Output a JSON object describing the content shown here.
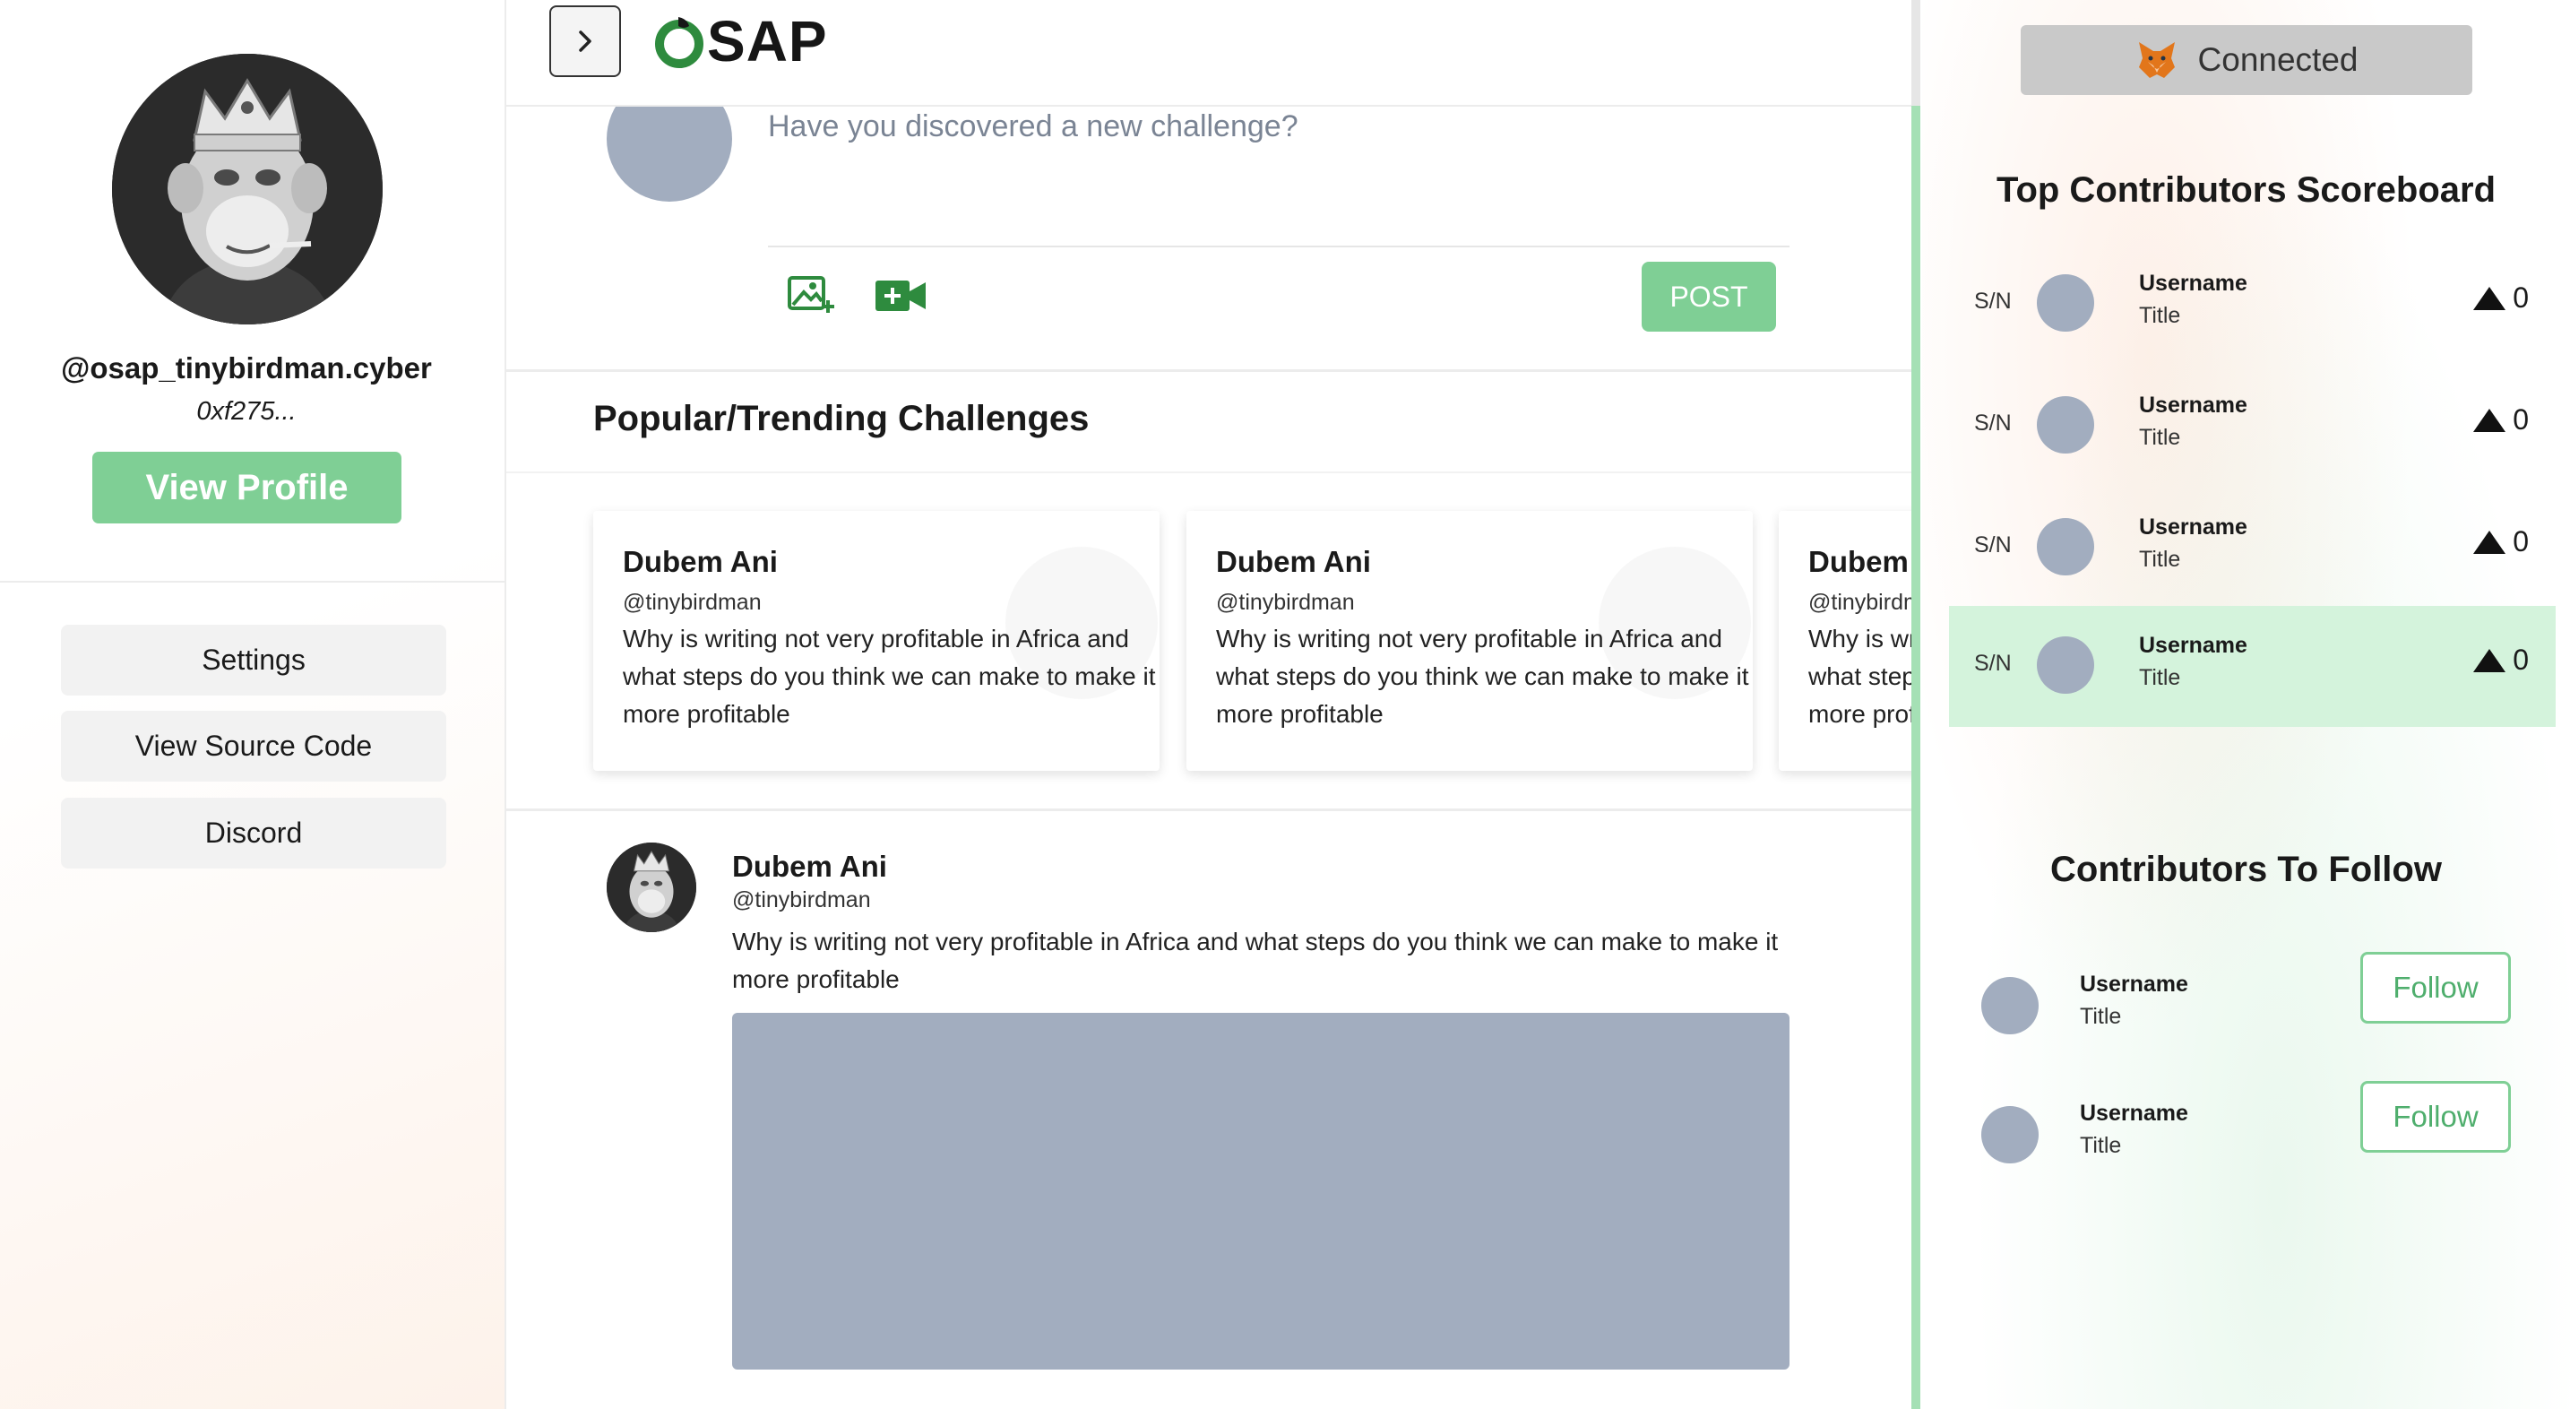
{
  "colors": {
    "accent_green": "#7fcf95",
    "placeholder_gray": "#a2adbf",
    "icon_green": "#2e8b3e",
    "highlight_row": "#d4f3dc"
  },
  "left": {
    "handle": "@osap_tinybirdman.cyber",
    "address": "0xf275...",
    "view_profile": "View Profile",
    "menu": [
      {
        "label": "Settings",
        "icon": "none"
      },
      {
        "label": "View Source Code",
        "icon": "none"
      },
      {
        "label": "Discord",
        "icon": "none"
      }
    ]
  },
  "topbar": {
    "logo_text": "SAP",
    "toggle_icon": "chevron-right-icon"
  },
  "composer": {
    "placeholder": "Have you discovered a new challenge?",
    "add_image_icon": "add-image-icon",
    "add_video_icon": "add-video-icon",
    "post_label": "POST"
  },
  "trending": {
    "title": "Popular/Trending Challenges",
    "cards": [
      {
        "name": "Dubem Ani",
        "handle": "@tinybirdman",
        "text": "Why is writing not very profitable in Africa and what steps do you think we can make to make it more profitable"
      },
      {
        "name": "Dubem Ani",
        "handle": "@tinybirdman",
        "text": "Why is writing not very profitable in Africa and what steps do you think we can make to make it more profitable"
      },
      {
        "name": "Dubem Ani",
        "handle": "@tinybirdman",
        "text": "Why is writing not very profitable in Africa and what steps do you think we can make to make it more profitable"
      }
    ]
  },
  "feed": {
    "name": "Dubem Ani",
    "handle": "@tinybirdman",
    "text": "Why is writing not very profitable in Africa and what steps do you think we can make to make it more profitable"
  },
  "right": {
    "connected_label": "Connected",
    "wallet_icon": "fox-icon",
    "scoreboard_title": "Top Contributors Scoreboard",
    "scoreboard": [
      {
        "sn": "S/N",
        "username": "Username",
        "title": "Title",
        "score": "0",
        "highlighted": false
      },
      {
        "sn": "S/N",
        "username": "Username",
        "title": "Title",
        "score": "0",
        "highlighted": false
      },
      {
        "sn": "S/N",
        "username": "Username",
        "title": "Title",
        "score": "0",
        "highlighted": false
      },
      {
        "sn": "S/N",
        "username": "Username",
        "title": "Title",
        "score": "0",
        "highlighted": true
      }
    ],
    "follow_title": "Contributors To Follow",
    "follow": [
      {
        "username": "Username",
        "title": "Title",
        "button": "Follow"
      },
      {
        "username": "Username",
        "title": "Title",
        "button": "Follow"
      }
    ]
  }
}
